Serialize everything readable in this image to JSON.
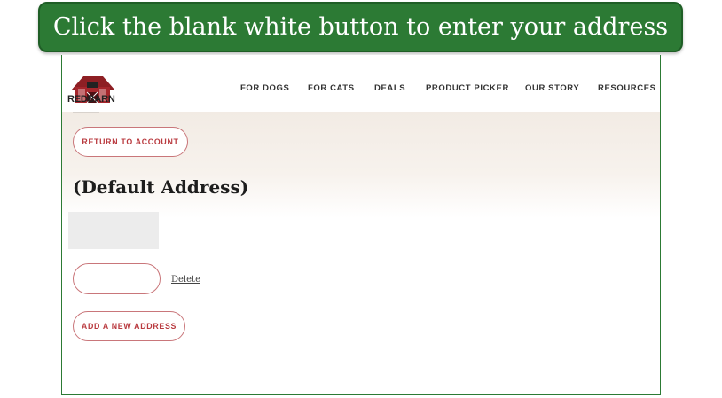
{
  "banner": {
    "text": "Click the blank white button to enter your address"
  },
  "brand": {
    "name": "REDBARN"
  },
  "nav": {
    "items": [
      {
        "label": "FOR DOGS"
      },
      {
        "label": "FOR CATS"
      },
      {
        "label": "DEALS"
      },
      {
        "label": "PRODUCT PICKER"
      },
      {
        "label": "OUR STORY"
      },
      {
        "label": "RESOURCES"
      }
    ]
  },
  "page": {
    "return_label": "RETURN TO ACCOUNT",
    "title": "(Default Address)",
    "edit_label": "",
    "delete_label": "Delete",
    "add_label": "ADD A NEW ADDRESS"
  },
  "colors": {
    "banner_bg": "#2c7a34",
    "accent_red": "#b93a3f",
    "pill_border": "#c9767a"
  }
}
